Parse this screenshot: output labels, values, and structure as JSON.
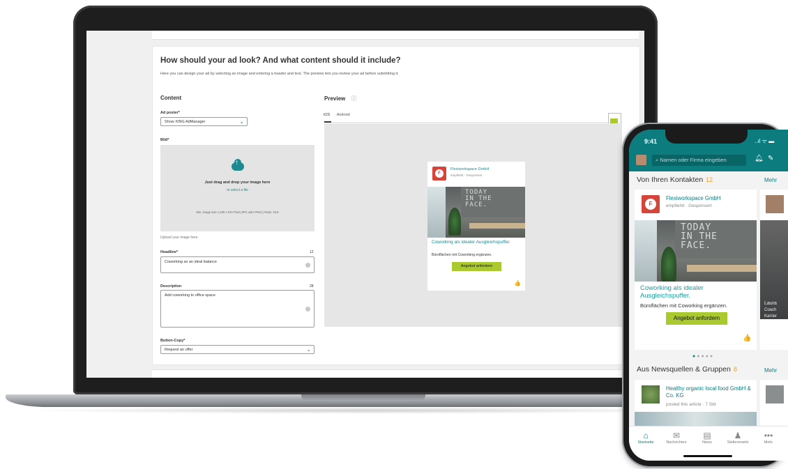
{
  "page": {
    "title": "How should your ad look? And what content should it include?",
    "intro": "Here you can design your ad by selecting an image and entering a header and text. The preview lets you review your ad before submitting it."
  },
  "content": {
    "section_title": "Content",
    "ad_poster_label": "Ad poster*",
    "ad_poster_value": "Show XING AdManager",
    "image_label": "Bild*",
    "upload_main": "Just drag and drop your image here",
    "upload_link": "or select a file",
    "upload_hint": "Min. image size 1,200 x 676 Pixel (JPG oder PNG) | Ratio: 16:9",
    "upload_caption": "Upload your image here.",
    "headline_label": "Headline*",
    "headline_count": "12",
    "headline_value": "Coworking as an ideal balance",
    "description_label": "Description",
    "description_count": "28",
    "description_value": "Add coworking to office space",
    "button_copy_label": "Button-Copy*",
    "button_copy_value": "Request an offer"
  },
  "preview": {
    "section_title": "Preview",
    "info_icon": "info-icon",
    "tabs": [
      "iOS",
      "Android"
    ],
    "active_tab": "iOS",
    "ad": {
      "company": "Flexiworkspace GmbH",
      "sub": "empfiehlt · Gesponsert",
      "logo_letter": "F",
      "image_text": "TODAY\nIN THE\nFACE.",
      "headline": "Coworking als idealer Ausgleichspuffer.",
      "description": "Büroflächen mit Coworking ergänzen.",
      "button": "Angebot anfordern"
    }
  },
  "phone": {
    "time": "9:41",
    "status": "..ıl ᯤ ▬",
    "search_placeholder": "Namen oder Firma eingeben",
    "section1": {
      "title": "Von Ihren Kontakten",
      "count": "12",
      "more": "Mehr"
    },
    "card": {
      "company": "Flexiworkspace GmbH",
      "sub": "empfiehlt · Gesponsert",
      "logo_letter": "F",
      "image_text": "TODAY\nIN THE\nFACE.",
      "headline": "Coworking als idealer Ausgleichspuffer.",
      "description": "Büroflächen mit Coworking ergänzen.",
      "button": "Angebot anfordern"
    },
    "side_card": {
      "line1": "Laura",
      "line2": "Coach",
      "line3": "Karrier"
    },
    "section2": {
      "title": "Aus Newsquellen & Gruppen",
      "count": "8",
      "more": "Mehr"
    },
    "news": {
      "company": "Healthy organic local food GmbH & Co. KG",
      "sub": "posted this article · 7 Std"
    },
    "tabs": [
      {
        "label": "Startseite",
        "icon": "home-icon",
        "glyph": "⌂"
      },
      {
        "label": "Nachrichten",
        "icon": "chat-icon",
        "glyph": "✉"
      },
      {
        "label": "News",
        "icon": "news-icon",
        "glyph": "▤"
      },
      {
        "label": "Stellenmarkt",
        "icon": "jobs-icon",
        "glyph": "♟"
      },
      {
        "label": "Mehr",
        "icon": "more-icon",
        "glyph": "•••"
      }
    ],
    "accent": "#0c7c7f",
    "button_color": "#a9c92f"
  }
}
